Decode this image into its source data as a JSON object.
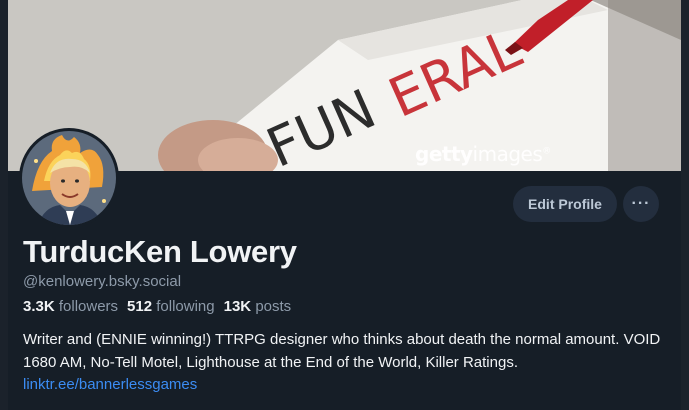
{
  "banner": {
    "watermark_bold": "getty",
    "watermark_light": "images",
    "watermark_mark": "®",
    "paper_text_black": "FUN",
    "paper_text_red": "ERAL"
  },
  "profile": {
    "display_name": "TurducKen Lowery",
    "handle": "@kenlowery.bsky.social",
    "avatar_alt": "avatar",
    "edit_label": "Edit Profile",
    "more_label": "···",
    "stats": {
      "followers_count": "3.3K",
      "followers_label": "followers",
      "following_count": "512",
      "following_label": "following",
      "posts_count": "13K",
      "posts_label": "posts"
    },
    "bio_text": "Writer and (ENNIE winning!) TTRPG designer who thinks about death the normal amount. VOID 1680 AM, No-Tell Motel, Lighthouse at the End of the World, Killer Ratings.",
    "bio_link": "linktr.ee/bannerlessgames"
  },
  "colors": {
    "background": "#161e27",
    "button_bg": "#232e3e",
    "link": "#3b8cf3",
    "accent_red": "#c8343a"
  }
}
